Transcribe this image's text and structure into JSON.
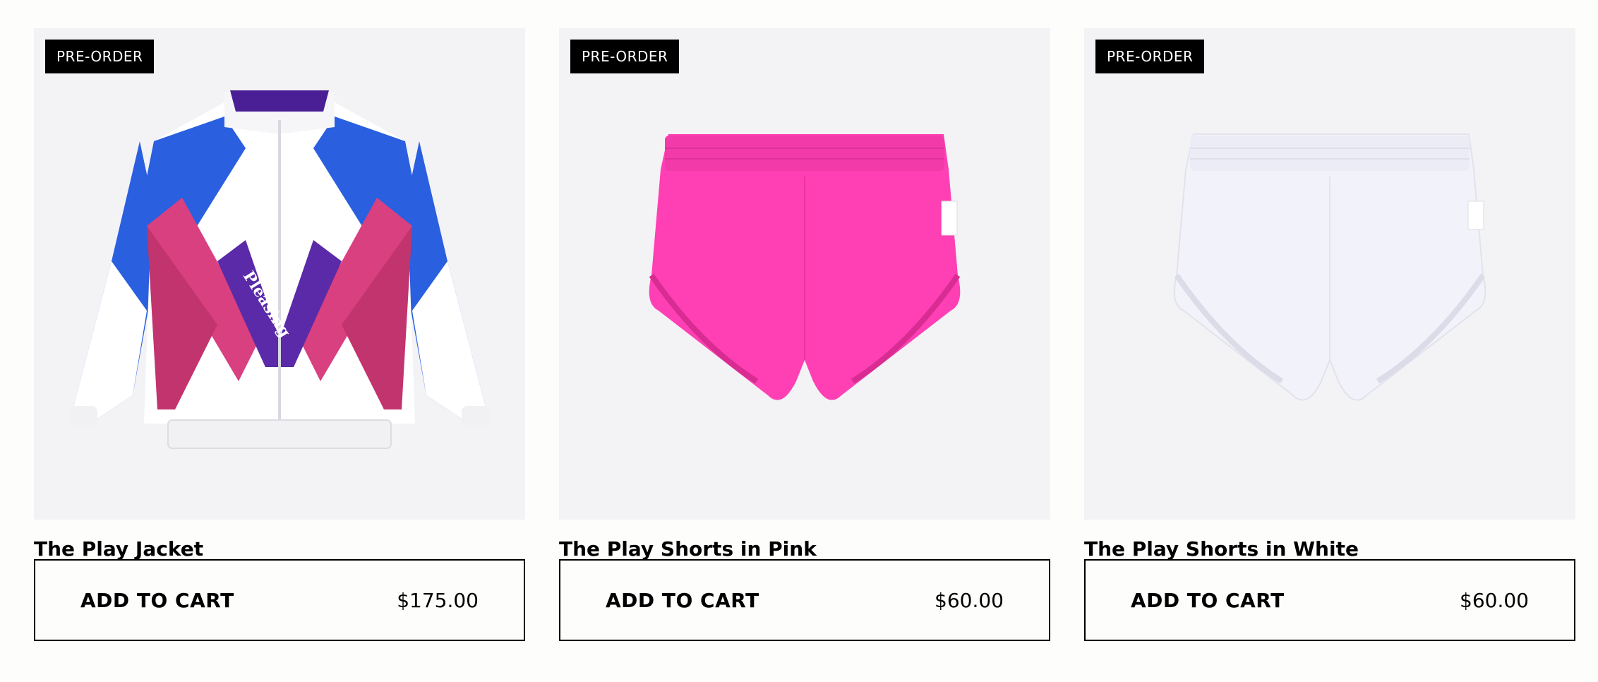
{
  "products": [
    {
      "badge": "PRE-ORDER",
      "title": "The Play Jacket",
      "button_label": "ADD TO CART",
      "price": "$175.00",
      "image": "jacket-icon",
      "logo_text": "Pleasing"
    },
    {
      "badge": "PRE-ORDER",
      "title": "The Play Shorts in Pink",
      "button_label": "ADD TO CART",
      "price": "$60.00",
      "image": "pink-shorts-icon",
      "color": "#ff3fb4"
    },
    {
      "badge": "PRE-ORDER",
      "title": "The Play Shorts in White",
      "button_label": "ADD TO CART",
      "price": "$60.00",
      "image": "white-shorts-icon",
      "color": "#f3f3fb"
    }
  ]
}
